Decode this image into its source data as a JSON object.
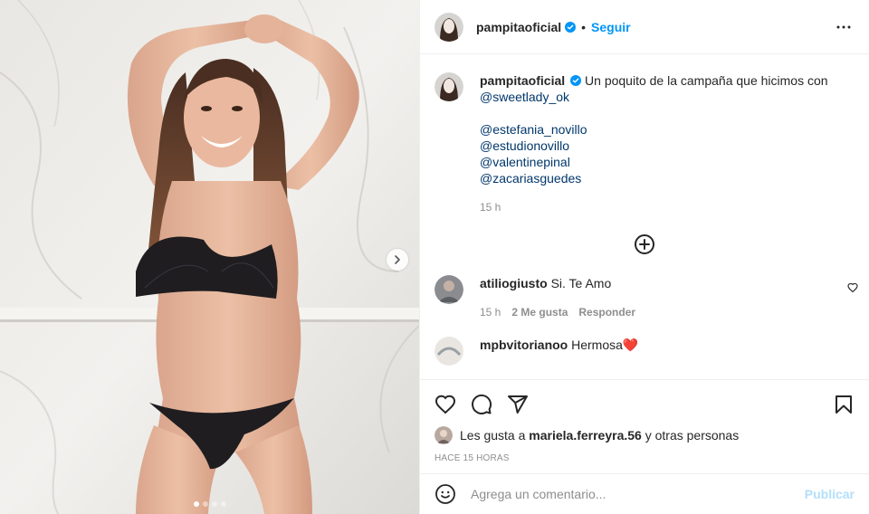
{
  "post_header": {
    "username": "pampitaoficial",
    "separator": "•",
    "follow_label": "Seguir",
    "more_icon": "more-horizontal-icon"
  },
  "caption": {
    "username": "pampitaoficial",
    "text": "Un poquito de la campaña que hicimos con",
    "mention_inline": "@sweetlady_ok",
    "mentions": [
      "@estefania_novillo",
      "@estudionovillo",
      "@valentinepinal",
      "@zacariasguedes"
    ],
    "time": "15 h"
  },
  "load_more_icon": "plus-circle-icon",
  "comments": [
    {
      "username": "atiliogiusto",
      "text": "Si. Te Amo",
      "time": "15 h",
      "likes": "2 Me gusta",
      "reply": "Responder"
    },
    {
      "username": "mpbvitorianoo",
      "text": "Hermosa",
      "emoji": "❤️"
    }
  ],
  "actions": {
    "like_icon": "heart-icon",
    "comment_icon": "comment-icon",
    "share_icon": "paper-plane-icon",
    "save_icon": "bookmark-icon"
  },
  "likes": {
    "prefix": "Les gusta a",
    "user": "mariela.ferreyra.56",
    "suffix": "y otras personas"
  },
  "post_time": "HACE 15 HORAS",
  "add_comment": {
    "placeholder": "Agrega un comentario...",
    "publish_label": "Publicar"
  },
  "colors": {
    "accent": "#0095f6",
    "publish_disabled": "#b2dffc",
    "mention": "#00376b",
    "muted": "#8e8e8e"
  },
  "carousel": {
    "total": 4,
    "active": 1
  }
}
